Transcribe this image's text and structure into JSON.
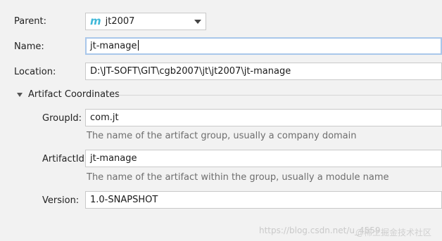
{
  "form": {
    "parent": {
      "label": "Parent:",
      "value": "jt2007",
      "icon": "maven-module-icon"
    },
    "name": {
      "label": "Name:",
      "value": "jt-manage"
    },
    "location": {
      "label": "Location:",
      "value": "D:\\JT-SOFT\\GIT\\cgb2007\\jt\\jt2007\\jt-manage"
    },
    "artifact_section": {
      "title": "Artifact Coordinates"
    },
    "group_id": {
      "label": "GroupId:",
      "value": "com.jt",
      "hint": "The name of the artifact group, usually a company domain"
    },
    "artifact_id": {
      "label": "ArtifactId:",
      "value": "jt-manage",
      "hint": "The name of the artifact within the group, usually a module name"
    },
    "version": {
      "label": "Version:",
      "value": "1.0-SNAPSHOT"
    }
  },
  "watermark": {
    "url": "https://blog.csdn.net/u_4559...",
    "brand": "@稀土掘金技术社区"
  }
}
